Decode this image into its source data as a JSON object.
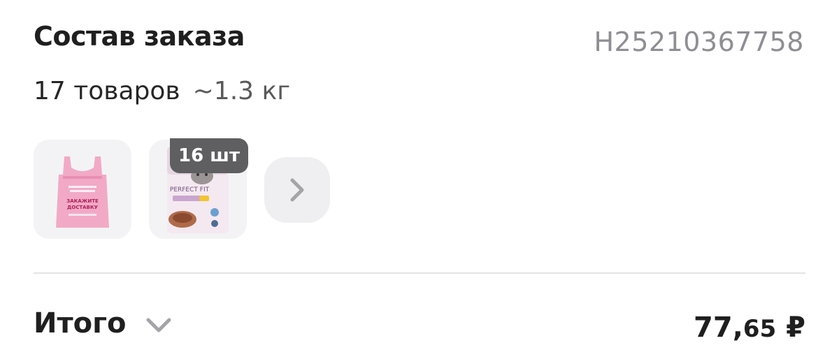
{
  "order": {
    "title": "Состав заказа",
    "number": "Н25210367758",
    "items_count": "17 товаров",
    "weight": "~1.3 кг"
  },
  "items": [
    {
      "name": "Пакет «Заказывайте доставку»",
      "icon": "shopping-bag",
      "color": "#f2a9c6",
      "printed_text": "ЗАКАЖИТЕ ДОСТАВКУ"
    },
    {
      "name": "Perfect Fit корм для кошек",
      "icon": "cat-food-pouch",
      "quantity": "16 шт",
      "printed_text": "PERFECT FIT"
    }
  ],
  "more": {
    "icon": "chevron-right-icon"
  },
  "total": {
    "label": "Итого",
    "amount_main": "77,",
    "amount_kop": "65",
    "currency": " ₽",
    "toggle_icon": "chevron-down-icon"
  },
  "colors": {
    "accent_text": "#1f1f1f",
    "muted": "#8e8e93",
    "badge": "#5f5f62",
    "bag_pink": "#f2a9c6"
  }
}
